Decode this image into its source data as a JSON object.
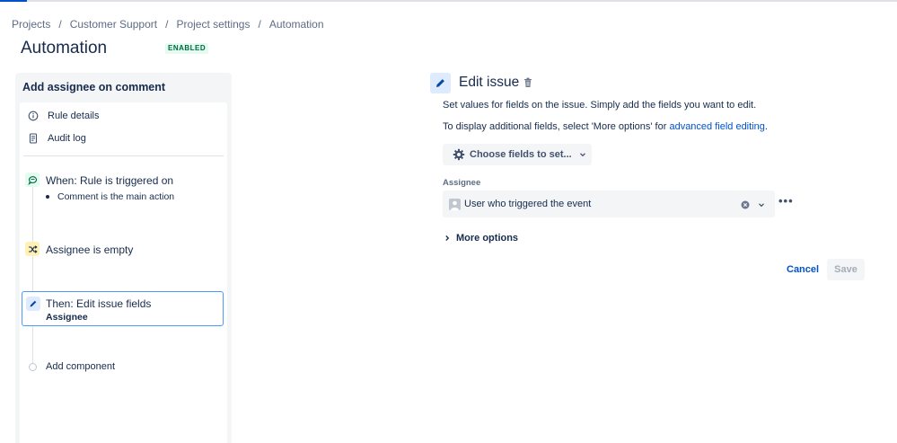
{
  "breadcrumb": {
    "items": [
      "Projects",
      "Customer Support",
      "Project settings",
      "Automation"
    ],
    "separator": "/"
  },
  "page": {
    "title": "Automation",
    "status": "ENABLED"
  },
  "rule": {
    "name": "Add assignee on comment",
    "nav": [
      {
        "label": "Rule details",
        "icon": "info-icon"
      },
      {
        "label": "Audit log",
        "icon": "document-icon"
      }
    ],
    "trigger": {
      "title": "When: Rule is triggered on",
      "bullet": "Comment is the main action",
      "icon": "comment-trigger-icon"
    },
    "condition": {
      "title": "Assignee is empty",
      "icon": "shuffle-icon"
    },
    "action": {
      "title": "Then: Edit issue fields",
      "subtitle": "Assignee",
      "icon": "pencil-icon"
    },
    "add_component": "Add component"
  },
  "editor": {
    "title": "Edit issue",
    "desc1": "Set values for fields on the issue. Simply add the fields you want to edit.",
    "desc2_prefix": "To display additional fields, select 'More options' for ",
    "desc2_link": "advanced field editing",
    "desc2_suffix": ".",
    "choose_button": "Choose fields to set...",
    "field_label": "Assignee",
    "field_value": "User who triggered the event",
    "more_options": "More options",
    "cancel": "Cancel",
    "save": "Save"
  },
  "colors": {
    "brand": "#0052cc",
    "enabled_bg": "#e3fcef",
    "enabled_text": "#006644",
    "trigger_bg": "#e3fcef",
    "condition_bg": "#fff0b3",
    "action_bg": "#deebff",
    "selected_border": "#4c9aff"
  }
}
